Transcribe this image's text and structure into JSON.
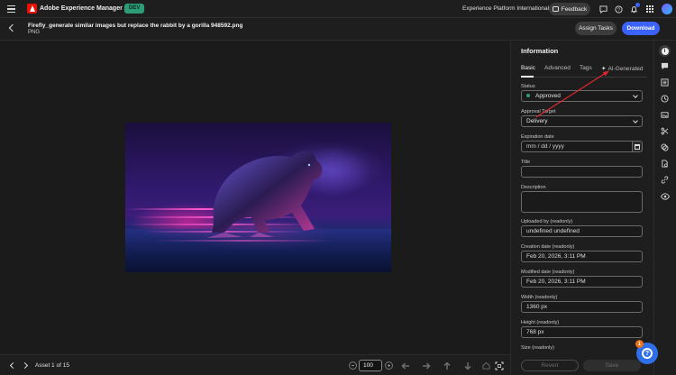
{
  "topbar": {
    "app_title": "Adobe Experience Manager Assets",
    "env_badge": "DEV",
    "org_name": "Experience Platform International",
    "feedback_label": "Feedback"
  },
  "header": {
    "file_name": "Firefly_generate similar images but replace the rabbit by a gorilla 948592.png",
    "file_type": "PNG",
    "assign_tasks_label": "Assign Tasks",
    "download_label": "Download"
  },
  "viewer": {
    "asset_counter": "Asset 1 of 15",
    "zoom_value": "100"
  },
  "panel": {
    "title": "Information",
    "tabs": [
      {
        "label": "Basic"
      },
      {
        "label": "Advanced"
      },
      {
        "label": "Tags"
      },
      {
        "label": "AI-Generated"
      }
    ],
    "fields": {
      "status": {
        "label": "Status",
        "value": "Approved",
        "dot_color": "#2d9d78"
      },
      "approval_target": {
        "label": "Approval Target",
        "value": "Delivery"
      },
      "expiration_date": {
        "label": "Expiration date",
        "placeholder": "mm / dd / yyyy"
      },
      "title": {
        "label": "Title",
        "value": ""
      },
      "description": {
        "label": "Description",
        "value": ""
      },
      "uploaded_by": {
        "label": "Uploaded by (readonly)",
        "value": "undefined undefined"
      },
      "creation_date": {
        "label": "Creation date (readonly)",
        "value": "Feb 20, 2026, 3:11 PM"
      },
      "modified_date": {
        "label": "Modified date (readonly)",
        "value": "Feb 20, 2026, 3:11 PM"
      },
      "width": {
        "label": "Width (readonly)",
        "value": "1360 px"
      },
      "height": {
        "label": "Height (readonly)",
        "value": "768 px"
      },
      "size": {
        "label": "Size (readonly)"
      }
    },
    "revert_label": "Revert",
    "save_label": "Save"
  },
  "help": {
    "badge_count": "1"
  },
  "colors": {
    "accent": "#3b63fb",
    "brand_red": "#eb1000",
    "env_badge": "#2d9d78",
    "annotation_arrow": "#e0282e",
    "help_badge": "#e8731c"
  }
}
